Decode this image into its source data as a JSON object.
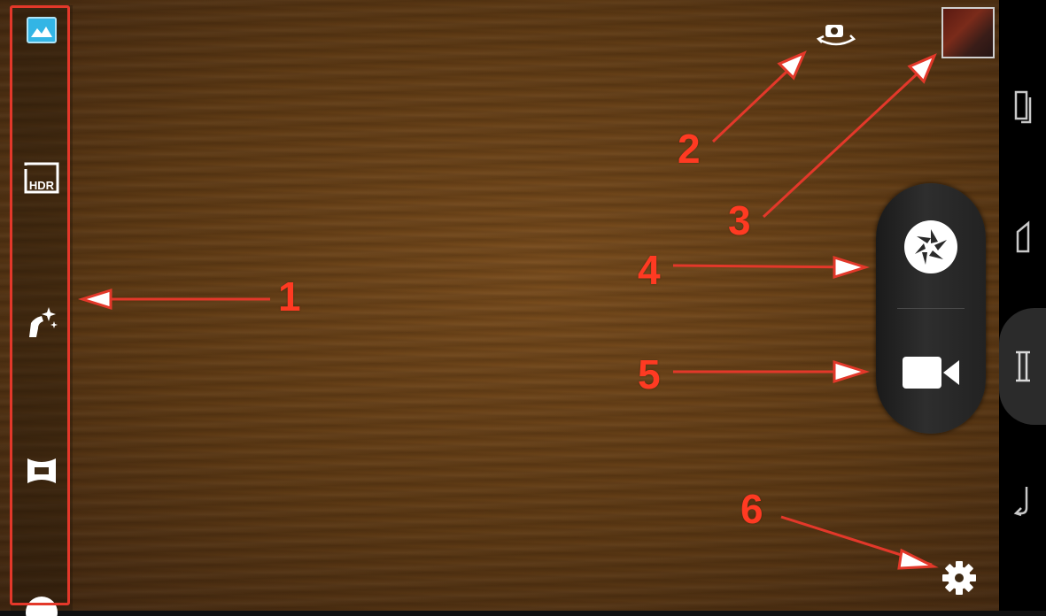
{
  "camera_modes": [
    {
      "name": "photo-mode-icon"
    },
    {
      "name": "hdr-mode-icon",
      "label": "HDR"
    },
    {
      "name": "effects-mode-icon"
    },
    {
      "name": "panorama-mode-icon"
    },
    {
      "name": "more-mode-icon"
    }
  ],
  "controls": {
    "switch_camera": "switch-camera-icon",
    "gallery_thumbnail": "gallery-thumbnail",
    "shutter": "shutter-icon",
    "video": "video-camera-icon",
    "settings": "gear-icon"
  },
  "nav_bar": [
    "recent-apps-icon",
    "home-icon",
    "screenshot-icon",
    "back-icon"
  ],
  "callouts": {
    "c1": "1",
    "c2": "2",
    "c3": "3",
    "c4": "4",
    "c5": "5",
    "c6": "6"
  },
  "colors": {
    "callout": "#ff3a22",
    "active_mode": "#33b5e5",
    "panel": "#2a2a2a"
  }
}
